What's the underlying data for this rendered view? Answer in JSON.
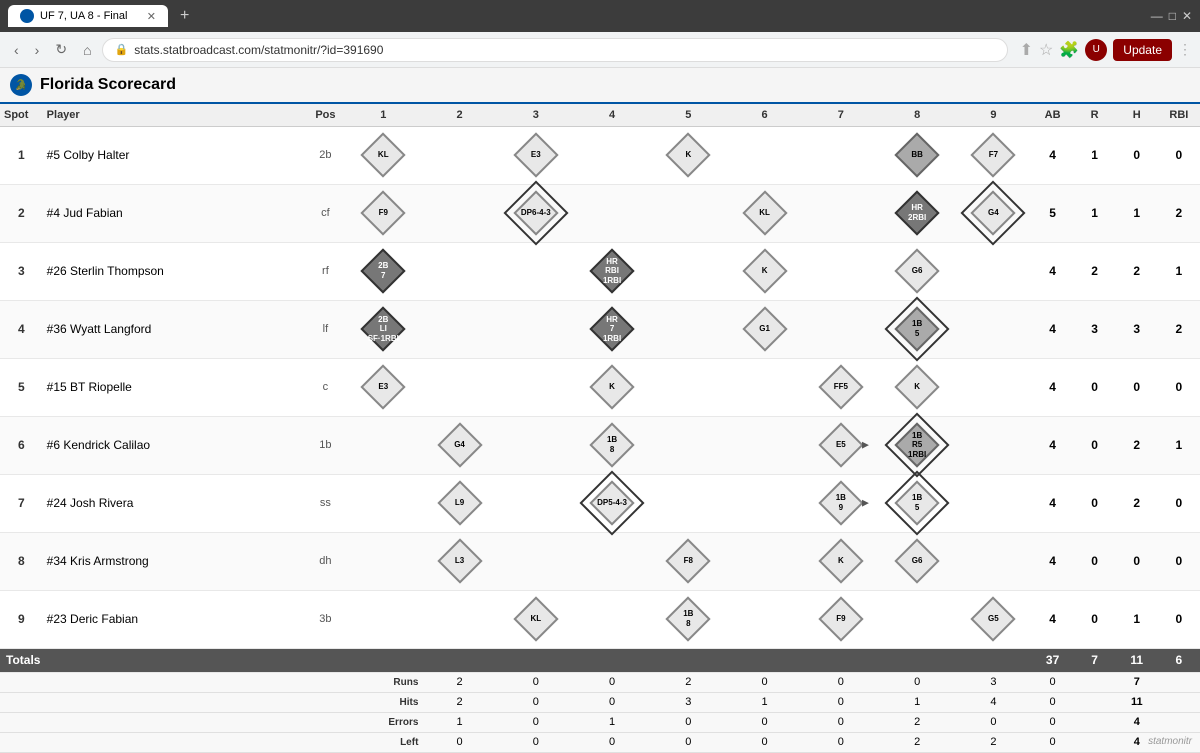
{
  "browser": {
    "tab_label": "UF 7, UA 8 - Final",
    "url": "stats.statbroadcast.com/statmonitr/?id=391690",
    "update_btn": "Update"
  },
  "page": {
    "title": "Florida Scorecard",
    "team_abbr": "F"
  },
  "table": {
    "headers": {
      "spot": "Spot",
      "player": "Player",
      "pos": "Pos",
      "innings": [
        "1",
        "2",
        "3",
        "4",
        "5",
        "6",
        "7",
        "8",
        "9"
      ],
      "ab": "AB",
      "r": "R",
      "h": "H",
      "rbi": "RBI"
    },
    "rows": [
      {
        "spot": "1",
        "player": "#5 Colby Halter",
        "pos": "2b",
        "at_bats": [
          {
            "inning": 1,
            "label": "KL",
            "style": "outline"
          },
          {
            "inning": 3,
            "label": "E3",
            "style": "outline"
          },
          {
            "inning": 5,
            "label": "K",
            "style": "outline"
          },
          {
            "inning": 8,
            "label": "BB",
            "style": "filled"
          },
          {
            "inning": 9,
            "label": "F7",
            "style": "outline"
          }
        ],
        "ab": 4,
        "r": 1,
        "h": 0,
        "rbi": 0
      },
      {
        "spot": "2",
        "player": "#4 Jud Fabian",
        "pos": "cf",
        "at_bats": [
          {
            "inning": 1,
            "label": "F9",
            "style": "outline"
          },
          {
            "inning": 3,
            "label": "DP6-4-3",
            "style": "outline",
            "double_border": true
          },
          {
            "inning": 6,
            "label": "KL",
            "style": "outline"
          },
          {
            "inning": 8,
            "label": "HR\n2RBI",
            "style": "dark_filled"
          },
          {
            "inning": 9,
            "label": "G4",
            "style": "outline",
            "double_border": true
          }
        ],
        "ab": 5,
        "r": 1,
        "h": 1,
        "rbi": 2
      },
      {
        "spot": "3",
        "player": "#26 Sterlin Thompson",
        "pos": "rf",
        "at_bats": [
          {
            "inning": 1,
            "label": "2B\n7",
            "style": "dark_filled"
          },
          {
            "inning": 4,
            "label": "HR\nRBI\n1RBI",
            "style": "dark_filled"
          },
          {
            "inning": 6,
            "label": "K",
            "style": "outline"
          },
          {
            "inning": 8,
            "label": "G6",
            "style": "outline"
          }
        ],
        "ab": 4,
        "r": 2,
        "h": 2,
        "rbi": 1
      },
      {
        "spot": "4",
        "player": "#36 Wyatt Langford",
        "pos": "lf",
        "at_bats": [
          {
            "inning": 1,
            "label": "2B\nLI\nSF·1RBI",
            "style": "dark_filled"
          },
          {
            "inning": 4,
            "label": "HR\n7\n1RBI",
            "style": "dark_filled"
          },
          {
            "inning": 6,
            "label": "G1",
            "style": "outline"
          },
          {
            "inning": 8,
            "label": "1B\n5",
            "style": "filled",
            "double_border": true
          }
        ],
        "ab": 4,
        "r": 3,
        "h": 3,
        "rbi": 2
      },
      {
        "spot": "5",
        "player": "#15 BT Riopelle",
        "pos": "c",
        "at_bats": [
          {
            "inning": 1,
            "label": "E3",
            "style": "outline"
          },
          {
            "inning": 4,
            "label": "K",
            "style": "outline"
          },
          {
            "inning": 7,
            "label": "FF5",
            "style": "outline"
          },
          {
            "inning": 8,
            "label": "K",
            "style": "outline"
          }
        ],
        "ab": 4,
        "r": 0,
        "h": 0,
        "rbi": 0
      },
      {
        "spot": "6",
        "player": "#6 Kendrick Calilao",
        "pos": "1b",
        "at_bats": [
          {
            "inning": 2,
            "label": "G4",
            "style": "outline"
          },
          {
            "inning": 4,
            "label": "1B\n8",
            "style": "outline"
          },
          {
            "inning": 7,
            "label": "E5",
            "style": "outline",
            "arrow": true
          },
          {
            "inning": 8,
            "label": "1B\nR5\n1RBI",
            "style": "filled",
            "double_border": true
          }
        ],
        "ab": 4,
        "r": 0,
        "h": 2,
        "rbi": 1
      },
      {
        "spot": "7",
        "player": "#24 Josh Rivera",
        "pos": "ss",
        "at_bats": [
          {
            "inning": 2,
            "label": "L9",
            "style": "outline"
          },
          {
            "inning": 4,
            "label": "DP5-4-3",
            "style": "outline",
            "double_border": true
          },
          {
            "inning": 7,
            "label": "1B\n9",
            "style": "outline",
            "arrow": true
          },
          {
            "inning": 8,
            "label": "1B\n5",
            "style": "outline",
            "double_border": true
          }
        ],
        "ab": 4,
        "r": 0,
        "h": 2,
        "rbi": 0
      },
      {
        "spot": "8",
        "player": "#34 Kris Armstrong",
        "pos": "dh",
        "at_bats": [
          {
            "inning": 2,
            "label": "L3",
            "style": "outline"
          },
          {
            "inning": 5,
            "label": "F8",
            "style": "outline"
          },
          {
            "inning": 7,
            "label": "K",
            "style": "outline"
          },
          {
            "inning": 8,
            "label": "G6",
            "style": "outline"
          }
        ],
        "ab": 4,
        "r": 0,
        "h": 0,
        "rbi": 0
      },
      {
        "spot": "9",
        "player": "#23 Deric Fabian",
        "pos": "3b",
        "at_bats": [
          {
            "inning": 3,
            "label": "KL",
            "style": "outline"
          },
          {
            "inning": 5,
            "label": "1B\n8",
            "style": "outline"
          },
          {
            "inning": 7,
            "label": "F9",
            "style": "outline"
          },
          {
            "inning": 9,
            "label": "G5",
            "style": "outline"
          }
        ],
        "ab": 4,
        "r": 0,
        "h": 1,
        "rbi": 0
      }
    ],
    "totals": {
      "label": "Totals",
      "ab": 37,
      "r": 7,
      "h": 11,
      "rbi": 6
    },
    "stats": {
      "rows": [
        {
          "label": "Runs",
          "values": [
            2,
            0,
            0,
            2,
            0,
            0,
            0,
            3,
            0
          ],
          "total": 7
        },
        {
          "label": "Hits",
          "values": [
            2,
            0,
            0,
            3,
            1,
            0,
            1,
            4,
            0
          ],
          "total": 11
        },
        {
          "label": "Errors",
          "values": [
            1,
            0,
            1,
            0,
            0,
            0,
            2,
            0,
            0
          ],
          "total": 4
        },
        {
          "label": "Left",
          "values": [
            0,
            0,
            0,
            0,
            0,
            0,
            2,
            2,
            0
          ],
          "total": 4
        }
      ]
    }
  },
  "watermark": "statmonitr"
}
